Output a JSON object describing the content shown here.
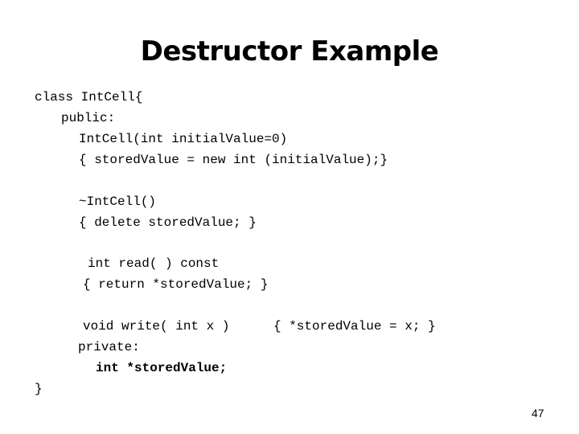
{
  "slide": {
    "title": "Destructor Example",
    "page_number": "47",
    "code_lines": [
      "class IntCell{",
      "public:",
      "IntCell(int initialValue=0)",
      "{ storedValue = new int (initialValue);}",
      "~IntCell()",
      "{ delete storedValue; }",
      "int read( ) const",
      "{ return *storedValue; }",
      "void write( int x )",
      "{ *storedValue = x; }",
      "private:",
      "int *storedValue;",
      "}"
    ]
  }
}
